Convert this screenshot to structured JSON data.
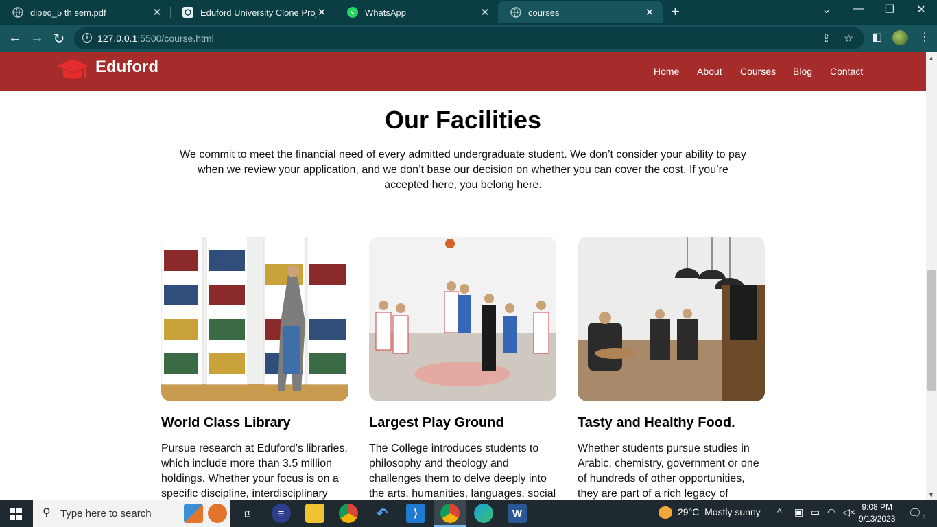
{
  "browser": {
    "tabs": [
      {
        "title": "dipeq_5 th sem.pdf",
        "active": false
      },
      {
        "title": "Eduford University Clone Project",
        "active": false
      },
      {
        "title": "WhatsApp",
        "active": false
      },
      {
        "title": "courses",
        "active": true
      }
    ],
    "url_host": "127.0.0.1",
    "url_rest": ":5500/course.html"
  },
  "site": {
    "logo": "Eduford",
    "nav": [
      "Home",
      "About",
      "Courses",
      "Blog",
      "Contact"
    ]
  },
  "facilities": {
    "title": "Our Facilities",
    "description": "We commit to meet the financial need of every admitted undergraduate student. We don’t consider your ability to pay when we review your application, and we don’t base our decision on whether you can cover the cost. If you’re accepted here, you belong here.",
    "cards": [
      {
        "title": "World Class Library",
        "text": "Pursue research at Eduford’s libraries, which include more than 3.5 million holdings. Whether your focus is on a specific discipline, interdisciplinary"
      },
      {
        "title": "Largest Play Ground",
        "text": "The College introduces students to philosophy and theology and challenges them to delve deeply into the arts, humanities, languages, social"
      },
      {
        "title": "Tasty and Healthy Food.",
        "text": "Whether students pursue studies in Arabic, chemistry, government or one of hundreds of other opportunities, they are part of a rich legacy of"
      }
    ]
  },
  "taskbar": {
    "search_placeholder": "Type here to search",
    "weather_temp": "29°C",
    "weather_desc": "Mostly sunny",
    "time": "9:08 PM",
    "date": "9/13/2023",
    "notification_count": "3"
  },
  "colors": {
    "brand": "#a62b2b",
    "chrome_dark": "#0b3d44",
    "chrome": "#17545c"
  }
}
